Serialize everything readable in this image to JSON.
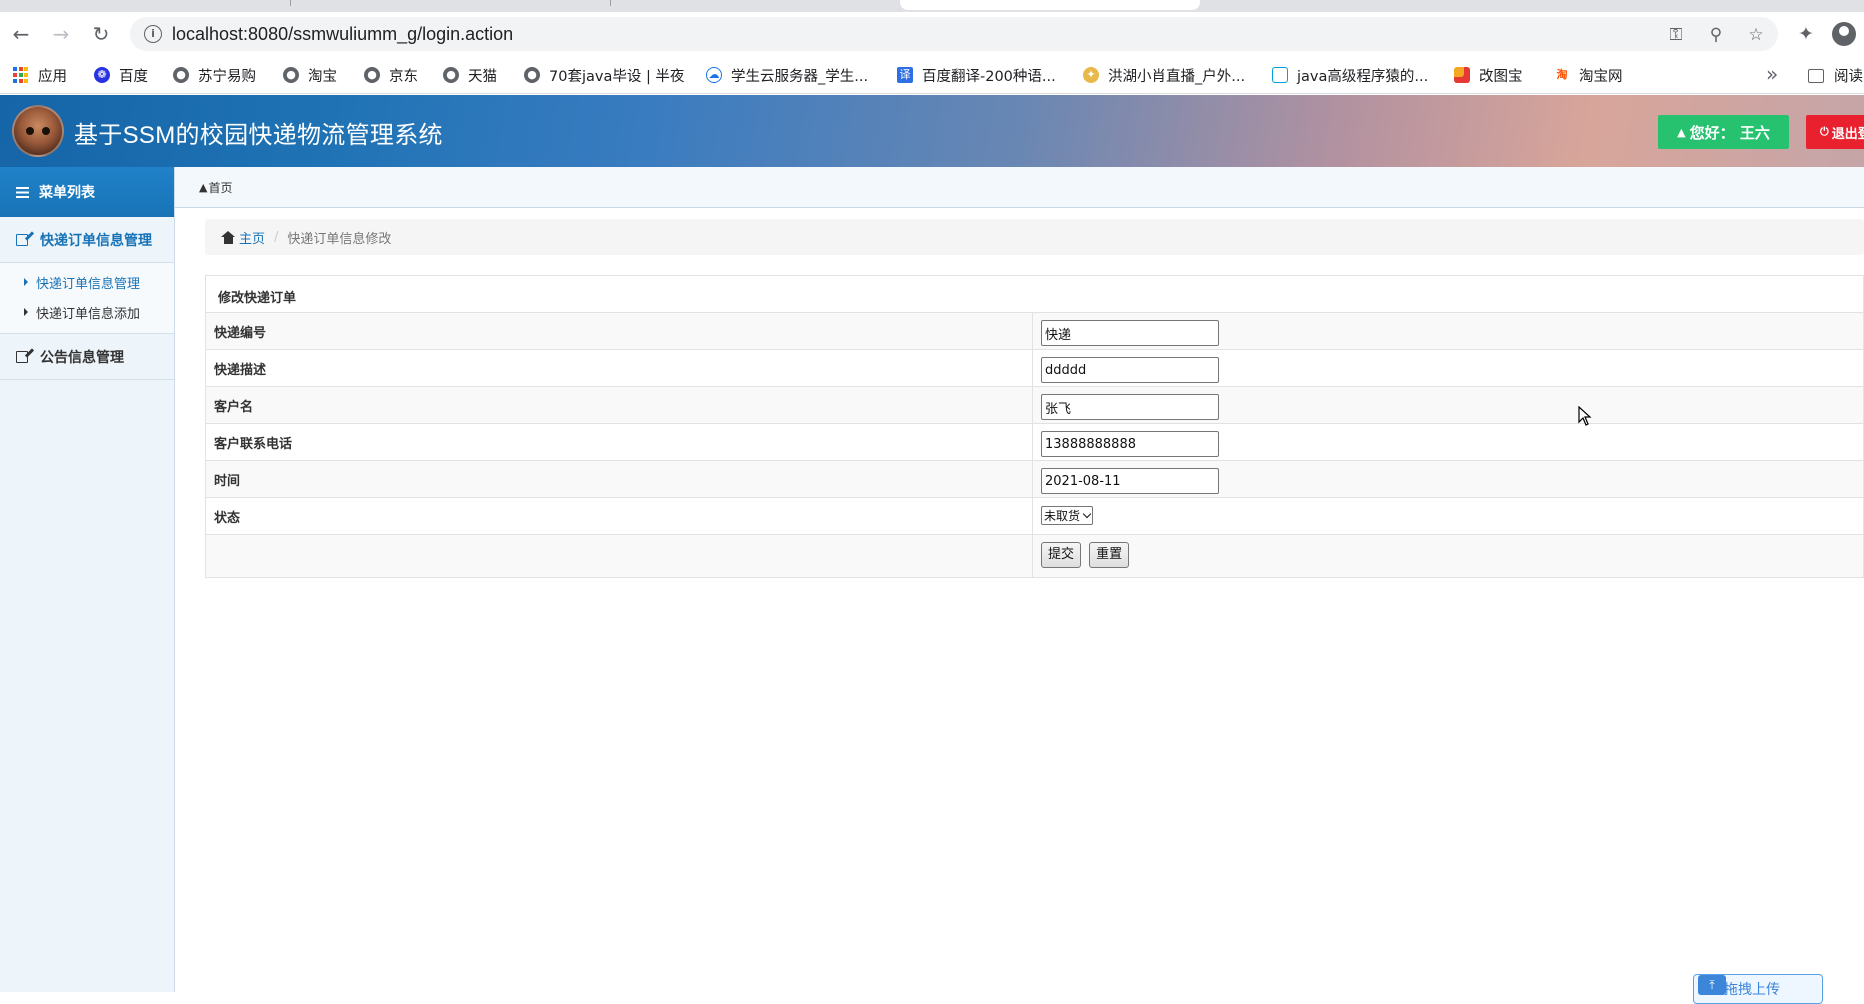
{
  "browser": {
    "url": "localhost:8080/ssmwuliumm_g/login.action",
    "bookmarks": [
      {
        "label": "应用",
        "icon": "apps-grid-icon"
      },
      {
        "label": "百度",
        "icon": "baidu-paw-icon"
      },
      {
        "label": "苏宁易购",
        "icon": "globe-icon"
      },
      {
        "label": "淘宝",
        "icon": "globe-icon"
      },
      {
        "label": "京东",
        "icon": "globe-icon"
      },
      {
        "label": "天猫",
        "icon": "globe-icon"
      },
      {
        "label": "70套java毕设 | 半夜",
        "icon": "globe-icon"
      },
      {
        "label": "学生云服务器_学生...",
        "icon": "cloud-icon"
      },
      {
        "label": "百度翻译-200种语...",
        "icon": "translate-icon"
      },
      {
        "label": "洪湖小肖直播_户外...",
        "icon": "bird-icon"
      },
      {
        "label": "java高级程序猿的...",
        "icon": "bilibili-icon"
      },
      {
        "label": "改图宝",
        "icon": "image-tool-icon"
      },
      {
        "label": "淘宝网",
        "icon": "taobao-icon"
      }
    ],
    "more_label": "»",
    "reading_list_label": "阅读"
  },
  "header": {
    "title": "基于SSM的校园快递物流管理系统",
    "greeting": "您好：  王六",
    "logout": "退出登"
  },
  "sidebar": {
    "title": "菜单列表",
    "groups": [
      {
        "label": "快递订单信息管理",
        "items": [
          "快递订单信息管理",
          "快递订单信息添加"
        ]
      },
      {
        "label": "公告信息管理"
      }
    ]
  },
  "main": {
    "top_crumb": "首页",
    "breadcrumb": {
      "home": "主页",
      "current": "快递订单信息修改"
    },
    "form": {
      "caption": "修改快递订单",
      "fields": [
        {
          "label": "快递编号",
          "value": "快递"
        },
        {
          "label": "快递描述",
          "value": "ddddd"
        },
        {
          "label": "客户名",
          "value": "张飞"
        },
        {
          "label": "客户联系电话",
          "value": "13888888888"
        },
        {
          "label": "时间",
          "value": "2021-08-11"
        }
      ],
      "status_label": "状态",
      "status_value": "未取货",
      "submit": "提交",
      "reset": "重置"
    }
  },
  "widget": {
    "upload_label": "拖拽上传"
  }
}
